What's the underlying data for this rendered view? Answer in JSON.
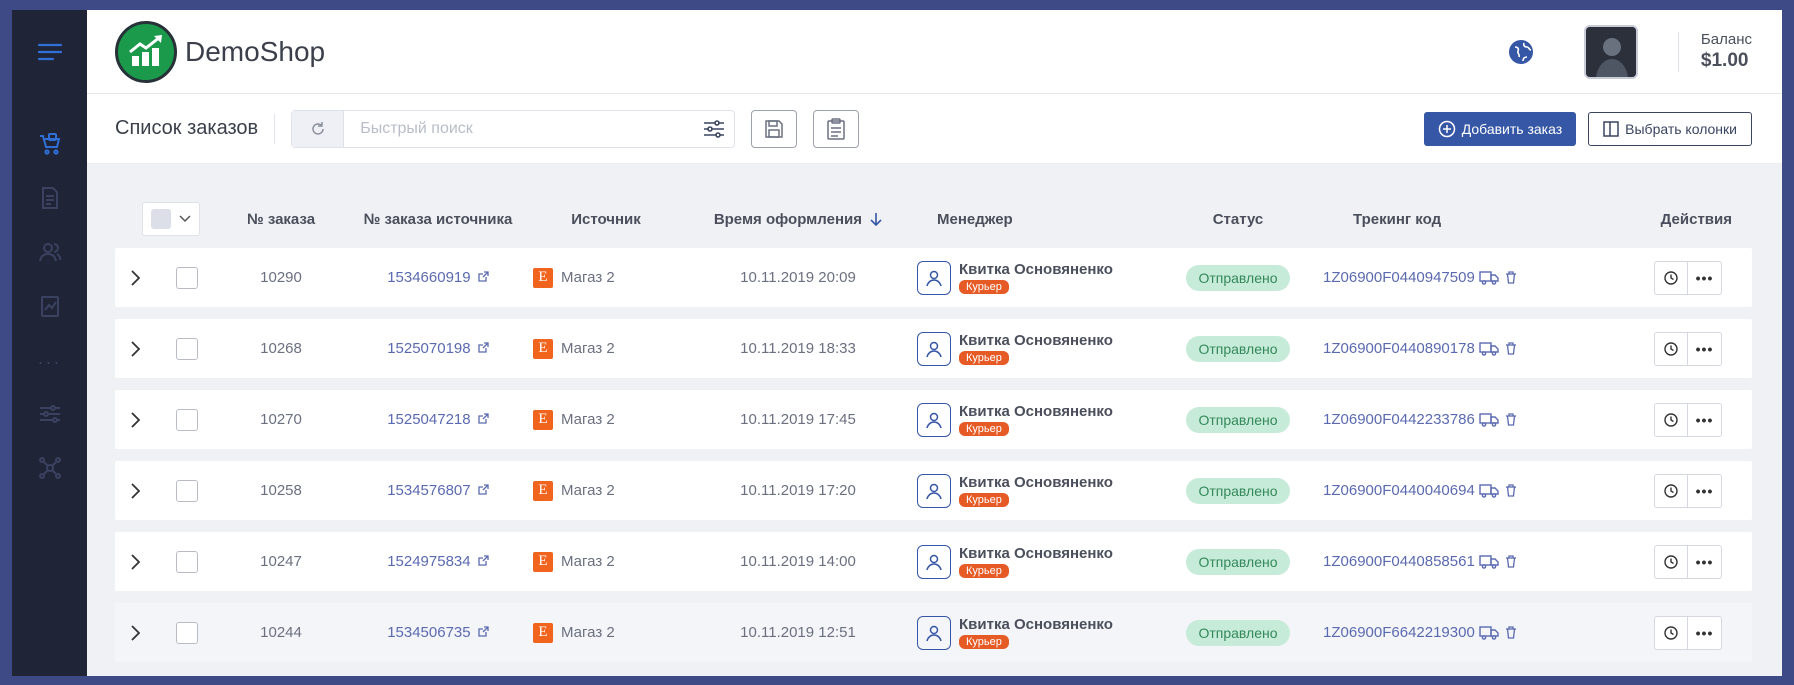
{
  "app": {
    "name": "DemoShop"
  },
  "header": {
    "balance_label": "Баланс",
    "balance_value": "$1.00"
  },
  "sidebar": {
    "items": [
      "orders-icon",
      "documents-icon",
      "users-icon",
      "reports-icon",
      "more-icon",
      "settings-icon",
      "integrations-icon"
    ]
  },
  "toolbar": {
    "title": "Список заказов",
    "search_placeholder": "Быстрый поиск",
    "add_order_label": "Добавить заказ",
    "choose_columns_label": "Выбрать колонки"
  },
  "table": {
    "headers": {
      "order_no": "№ заказа",
      "source_order_no": "№ заказа источника",
      "source": "Источник",
      "created": "Время оформления",
      "manager": "Менеджер",
      "status": "Статус",
      "tracking": "Трекинг код",
      "actions": "Действия"
    },
    "rows": [
      {
        "order_no": "10290",
        "source_order_no": "1534660919",
        "source": "Магаз 2",
        "created": "10.11.2019 20:09",
        "manager": "Квитка Основяненко",
        "role": "Курьер",
        "status": "Отправлено",
        "tracking": "1Z06900F0440947509"
      },
      {
        "order_no": "10268",
        "source_order_no": "1525070198",
        "source": "Магаз 2",
        "created": "10.11.2019 18:33",
        "manager": "Квитка Основяненко",
        "role": "Курьер",
        "status": "Отправлено",
        "tracking": "1Z06900F0440890178"
      },
      {
        "order_no": "10270",
        "source_order_no": "1525047218",
        "source": "Магаз 2",
        "created": "10.11.2019 17:45",
        "manager": "Квитка Основяненко",
        "role": "Курьер",
        "status": "Отправлено",
        "tracking": "1Z06900F0442233786"
      },
      {
        "order_no": "10258",
        "source_order_no": "1534576807",
        "source": "Магаз 2",
        "created": "10.11.2019 17:20",
        "manager": "Квитка Основяненко",
        "role": "Курьер",
        "status": "Отправлено",
        "tracking": "1Z06900F0440040694"
      },
      {
        "order_no": "10247",
        "source_order_no": "1524975834",
        "source": "Магаз 2",
        "created": "10.11.2019 14:00",
        "manager": "Квитка Основяненко",
        "role": "Курьер",
        "status": "Отправлено",
        "tracking": "1Z06900F0440858561"
      },
      {
        "order_no": "10244",
        "source_order_no": "1534506735",
        "source": "Магаз 2",
        "created": "10.11.2019 12:51",
        "manager": "Квитка Основяненко",
        "role": "Курьер",
        "status": "Отправлено",
        "tracking": "1Z06900F6642219300"
      }
    ]
  },
  "colors": {
    "primary": "#3656a6",
    "sidebar": "#1f2437",
    "status_bg": "#c6ecd9",
    "status_text": "#35885a",
    "badge": "#e55a25",
    "etsy": "#f1641e"
  }
}
